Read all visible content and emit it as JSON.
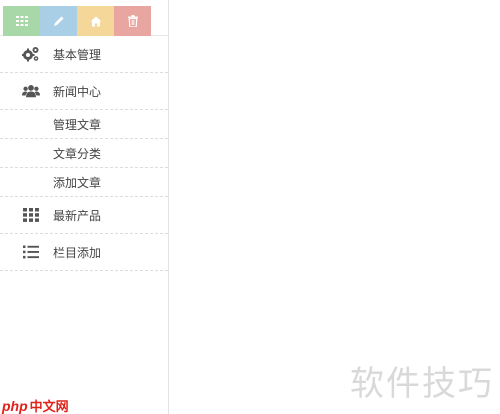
{
  "shortcuts": [
    {
      "name": "grid-icon",
      "color": "#a8d8a8"
    },
    {
      "name": "pencil-icon",
      "color": "#a8cfe6"
    },
    {
      "name": "home-icon",
      "color": "#f6d79a"
    },
    {
      "name": "trash-icon",
      "color": "#e9a5a0"
    }
  ],
  "menu": {
    "basic_management": {
      "label": "基本管理",
      "icon": "gears-icon"
    },
    "news_center": {
      "label": "新闻中心",
      "icon": "users-icon",
      "children": [
        "管理文章",
        "文章分类",
        "添加文章"
      ]
    },
    "latest_products": {
      "label": "最新产品",
      "icon": "grid-icon"
    },
    "column_add": {
      "label": "栏目添加",
      "icon": "list-icon"
    }
  },
  "watermark": {
    "site_cn": "软件技巧",
    "php_prefix": "php",
    "php_suffix": "中文网"
  }
}
